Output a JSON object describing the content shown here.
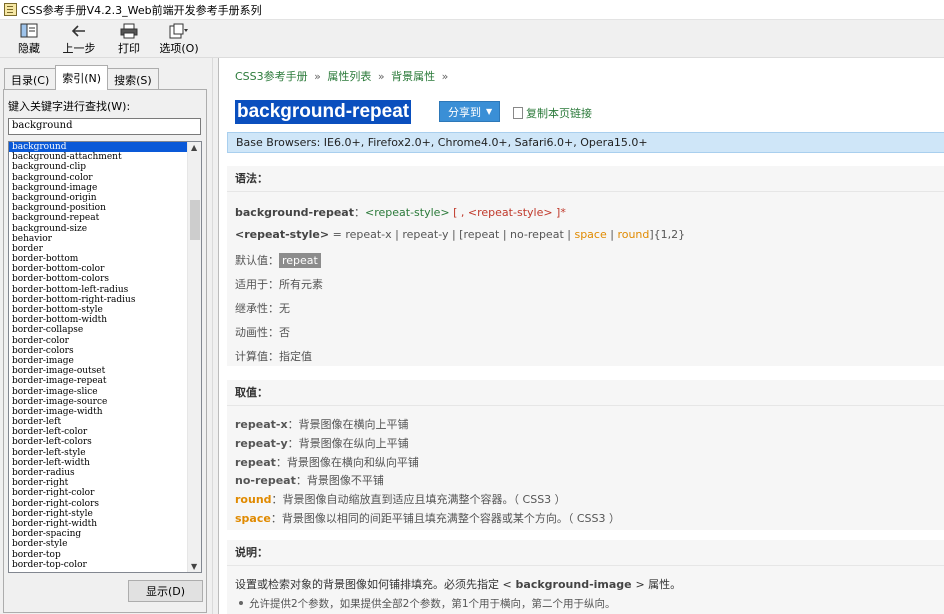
{
  "window": {
    "title": "CSS参考手册V4.2.3_Web前端开发参考手册系列"
  },
  "toolbar": [
    {
      "label": "隐藏",
      "icon": "hide-icon"
    },
    {
      "label": "上一步",
      "icon": "back-arrow-icon"
    },
    {
      "label": "打印",
      "icon": "printer-icon"
    },
    {
      "label": "选项(O)",
      "icon": "options-icon"
    }
  ],
  "sidebar": {
    "tabs": [
      "目录(C)",
      "索引(N)",
      "搜索(S)"
    ],
    "active_tab": "索引(N)",
    "keyword_label": "键入关键字进行查找(W):",
    "keyword_value": "background",
    "show_button": "显示(D)",
    "selected_item": "background",
    "items": [
      "background",
      "background-attachment",
      "background-clip",
      "background-color",
      "background-image",
      "background-origin",
      "background-position",
      "background-repeat",
      "background-size",
      "behavior",
      "border",
      "border-bottom",
      "border-bottom-color",
      "border-bottom-colors",
      "border-bottom-left-radius",
      "border-bottom-right-radius",
      "border-bottom-style",
      "border-bottom-width",
      "border-collapse",
      "border-color",
      "border-colors",
      "border-image",
      "border-image-outset",
      "border-image-repeat",
      "border-image-slice",
      "border-image-source",
      "border-image-width",
      "border-left",
      "border-left-color",
      "border-left-colors",
      "border-left-style",
      "border-left-width",
      "border-radius",
      "border-right",
      "border-right-color",
      "border-right-colors",
      "border-right-style",
      "border-right-width",
      "border-spacing",
      "border-style",
      "border-top",
      "border-top-color"
    ]
  },
  "content": {
    "breadcrumb": [
      "CSS3参考手册",
      "属性列表",
      "背景属性"
    ],
    "breadcrumb_sep": "»",
    "title": "background-repeat",
    "share_label": "分享到",
    "copy_link": "复制本页链接",
    "browsers": "Base Browsers: IE6.0+, Firefox2.0+, Chrome4.0+, Safari6.0+, Opera15.0+",
    "syntax": {
      "heading": "语法：",
      "line1_prop": "background-repeat",
      "line1_sep": "：",
      "line1_value": "<repeat-style>",
      "line1_rest": "[ , <repeat-style> ]*",
      "line2_term": "<repeat-style>",
      "line2_eq": " = repeat-x | repeat-y | [repeat | no-repeat | ",
      "line2_space": "space",
      "line2_pipe": " | ",
      "line2_round": "round",
      "line2_end": "]{1,2}",
      "default_label": "默认值：",
      "default_value": "repeat",
      "applies_label": "适用于：",
      "applies_value": "所有元素",
      "inherit_label": "继承性：",
      "inherit_value": "无",
      "anim_label": "动画性：",
      "anim_value": "否",
      "computed_label": "计算值：",
      "computed_value": "指定值"
    },
    "values": {
      "heading": "取值：",
      "items": [
        {
          "key": "repeat-x",
          "desc": "：背景图像在横向上平铺",
          "color": "#555555"
        },
        {
          "key": "repeat-y",
          "desc": "：背景图像在纵向上平铺",
          "color": "#555555"
        },
        {
          "key": "repeat",
          "desc": "：背景图像在横向和纵向平铺",
          "color": "#555555"
        },
        {
          "key": "no-repeat",
          "desc": "：背景图像不平铺",
          "color": "#555555"
        },
        {
          "key": "round",
          "desc": "：背景图像自动缩放直到适应且填充满整个容器。（ CSS3 ）",
          "color": "#e08a00"
        },
        {
          "key": "space",
          "desc": "：背景图像以相同的间距平铺且填充满整个容器或某个方向。（ CSS3 ）",
          "color": "#e08a00"
        }
      ]
    },
    "notes": {
      "heading": "说明：",
      "line1_pre": "设置或检索对象的背景图像如何铺排填充。必须先指定 <",
      "line1_link": " background-image ",
      "line1_post": "> 属性。",
      "bullet1": "允许提供2个参数，如果提供全部2个参数，第1个用于横向，第二个用于纵向。"
    }
  },
  "colors": {
    "accent": "#0a4fbe",
    "link": "#2b7a3a",
    "css3": "#e08a00",
    "selection": "#0a59d8"
  }
}
